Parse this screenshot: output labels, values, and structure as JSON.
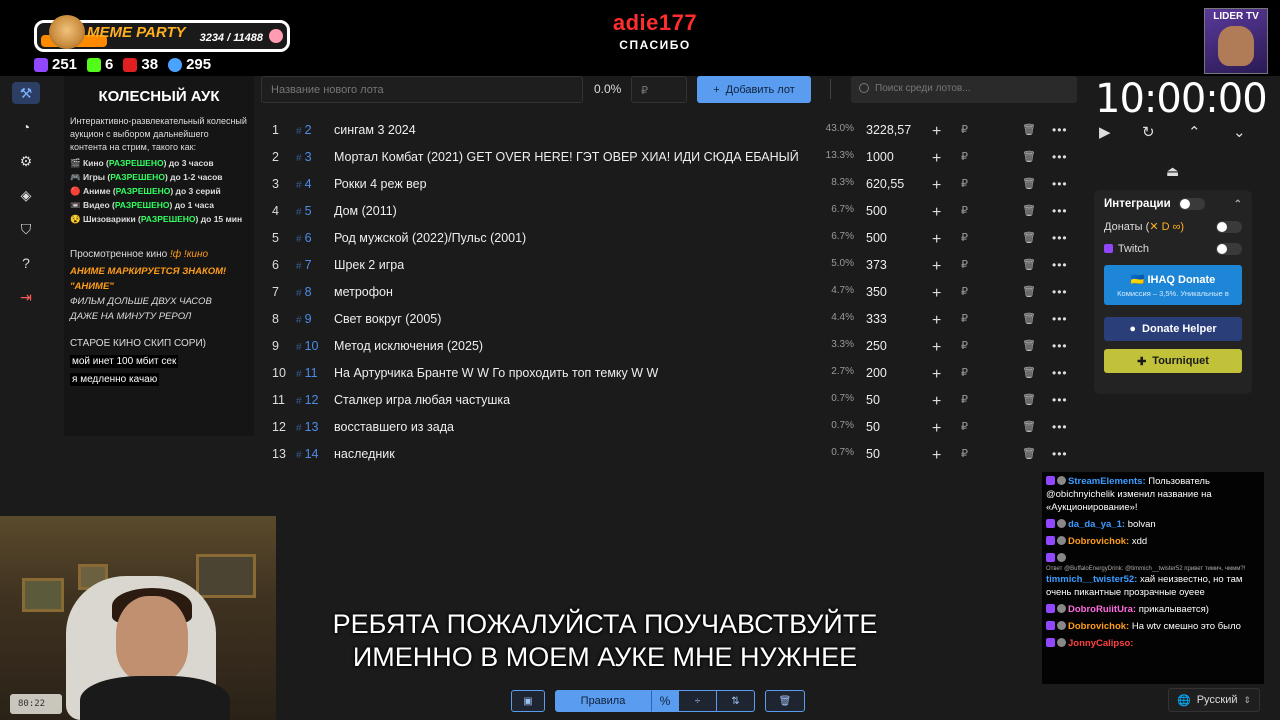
{
  "overlay": {
    "meme_title": "MEME PARTY",
    "meme_count": "3234 / 11488",
    "stats": [
      {
        "icon": "twitch-icon",
        "value": "251"
      },
      {
        "icon": "kick-icon",
        "value": "6"
      },
      {
        "icon": "live-icon",
        "value": "38"
      },
      {
        "icon": "viewers-icon",
        "value": "295"
      }
    ],
    "streamer_name": "adie177",
    "streamer_sub": "СПАСИБО",
    "lider_label": "LIDER TV"
  },
  "sidebar": {
    "items": [
      "hammer-icon",
      "pie-chart-icon",
      "gear-icon",
      "layers-icon",
      "shield-icon",
      "help-icon",
      "logout-icon"
    ]
  },
  "description": {
    "title": "КОЛЕСНЫЙ АУК",
    "intro": "Интерактивно-развлекательный колесный аукцион с выбором дальнейшего контента на стрим, такого как:",
    "categories": [
      {
        "pre": "Кино (",
        "allowed": "РАЗРЕШЕНО",
        "post": ") до 3 часов"
      },
      {
        "pre": "Игры (",
        "allowed": "РАЗРЕШЕНО",
        "post": ") до 1-2 часов"
      },
      {
        "pre": "Аниме (",
        "allowed": "РАЗРЕШЕНО",
        "post": ") до 3 серий"
      },
      {
        "pre": "Видео (",
        "allowed": "РАЗРЕШЕНО",
        "post": ") до 1 часа"
      },
      {
        "pre": "Шизоварики (",
        "allowed": "РАЗРЕШЕНО",
        "post": ") до 15 мин"
      }
    ],
    "watched_label": "Просмотренное кино",
    "watched_cmd": "!ф !кино",
    "anime_note_1": "АНИМЕ МАРКИРУЕТСЯ ЗНАКОМ!",
    "anime_note_2": "\"АНИМЕ\"",
    "film_note_1": "ФИЛЬМ ДОЛЬШЕ ДВУХ ЧАСОВ",
    "film_note_2": "ДАЖЕ НА МИНУТУ РЕРОЛ",
    "old_note": "СТАРОЕ КИНО СКИП СОРИ)",
    "internet_1": "мой инет 100 мбит сек",
    "internet_2": "я медленно качаю"
  },
  "controls": {
    "lot_placeholder": "Название нового лота",
    "percent": "0.0%",
    "rub_placeholder": "₽",
    "add_label": "Добавить лот",
    "search_placeholder": "Поиск среди лотов..."
  },
  "lots": [
    {
      "n": "1",
      "id": "2",
      "name": "сингам 3 2024",
      "pct": "43.0%",
      "amount": "3228,57"
    },
    {
      "n": "2",
      "id": "3",
      "name": "Мортал Комбат (2021) GET OVER HERE! ГЭТ ОВЕР ХИА! ИДИ СЮДА ЕБАНЫЙ",
      "pct": "13.3%",
      "amount": "1000"
    },
    {
      "n": "3",
      "id": "4",
      "name": "Рокки 4 реж вер",
      "pct": "8.3%",
      "amount": "620,55"
    },
    {
      "n": "4",
      "id": "5",
      "name": "Дом (2011)",
      "pct": "6.7%",
      "amount": "500"
    },
    {
      "n": "5",
      "id": "6",
      "name": " Род мужской (2022)/Пульс (2001)",
      "pct": "6.7%",
      "amount": "500"
    },
    {
      "n": "6",
      "id": "7",
      "name": "Шрек 2 игра",
      "pct": "5.0%",
      "amount": "373"
    },
    {
      "n": "7",
      "id": "8",
      "name": "метрофон",
      "pct": "4.7%",
      "amount": "350"
    },
    {
      "n": "8",
      "id": "9",
      "name": "Свет вокруг (2005)",
      "pct": "4.4%",
      "amount": "333"
    },
    {
      "n": "9",
      "id": "10",
      "name": " Метод исключения (2025)",
      "pct": "3.3%",
      "amount": "250"
    },
    {
      "n": "10",
      "id": "11",
      "name": "На Артурчика Бранте W W Го проходить топ темку W W",
      "pct": "2.7%",
      "amount": "200"
    },
    {
      "n": "11",
      "id": "12",
      "name": " Сталкер игра любая частушка",
      "pct": "0.7%",
      "amount": "50"
    },
    {
      "n": "12",
      "id": "13",
      "name": " восставшего из зада",
      "pct": "0.7%",
      "amount": "50"
    },
    {
      "n": "13",
      "id": "14",
      "name": " наследник",
      "pct": "0.7%",
      "amount": "50"
    }
  ],
  "timer": {
    "value": "10:00:00"
  },
  "integrations": {
    "title": "Интеграции",
    "donates_label": "Донаты (",
    "twitch_label": "Twitch",
    "ihaq_label": "IHAQ Donate",
    "ihaq_sub": "Комиссия – 3,5%. Уникальные в",
    "donate_helper_label": "Donate Helper",
    "tourniquet_label": "Tourniquet"
  },
  "chat": [
    {
      "user": "StreamElements:",
      "color": "u-blue",
      "text": "Пользователь @obichnyichelik изменил название на «Аукционирование»!"
    },
    {
      "user": "da_da_ya_1:",
      "color": "u-blue",
      "text": "bolvan"
    },
    {
      "user": "Dobrovichok:",
      "color": "u-orange",
      "text": "xdd"
    },
    {
      "user": "timmich__twister52:",
      "color": "u-blue",
      "reply": "Ответ @BuffaloEnergyDrink: @timmich__twister52 привет тимич, чммм?!",
      "text": "хай неизвестно, но там очень пикантные прозрачные оуеее"
    },
    {
      "user": "DobroRuiitUra:",
      "color": "u-pink",
      "text": "прикалывается)"
    },
    {
      "user": "Dobrovichok:",
      "color": "u-orange",
      "text": "На wtv смешно это было"
    },
    {
      "user": "JonnyCalipso:",
      "color": "u-red",
      "text": ""
    }
  ],
  "subtitle": {
    "line1": "РЕБЯТА ПОЖАЛУЙСТА ПОУЧАВСТВУЙТЕ",
    "line2": "ИМЕННО В МОЕМ АУКЕ МНЕ НУЖНЕЕ"
  },
  "webcam": {
    "clock_text": "80:22"
  },
  "toolbar": {
    "rules_label": "Правила",
    "percent_label": "%"
  },
  "language": {
    "label": "Русский"
  },
  "colors": {
    "accent": "#5a9cf0",
    "allowed": "#30ff60",
    "warning": "#ff9d1a",
    "streamer": "#ff2d2d"
  }
}
